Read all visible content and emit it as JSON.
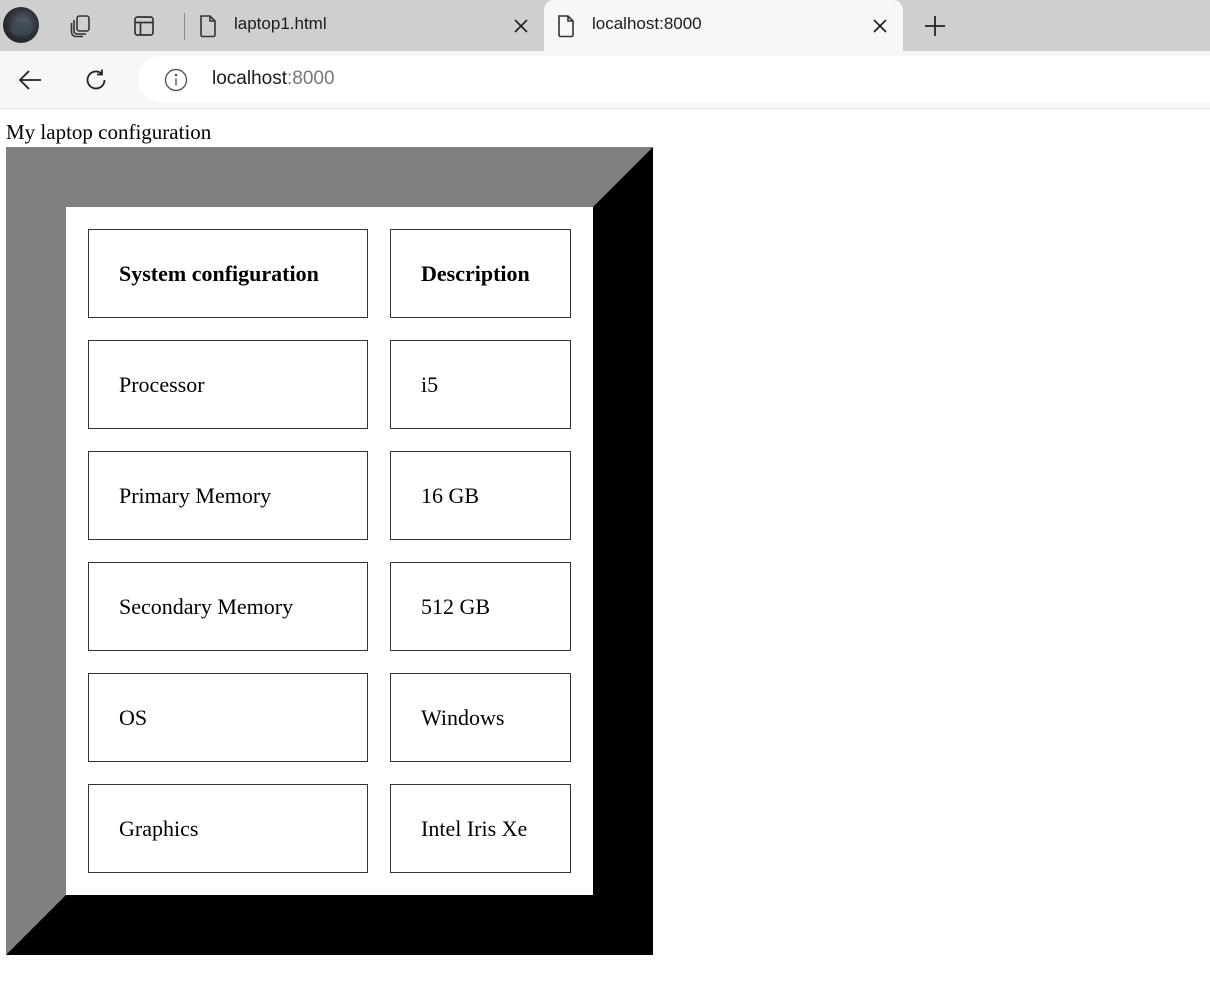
{
  "browser": {
    "tabs": [
      {
        "label": "laptop1.html",
        "active": false
      },
      {
        "label": "localhost:8000",
        "active": true
      }
    ],
    "address": {
      "host": "localhost",
      "port": ":8000"
    }
  },
  "page": {
    "title": "My laptop configuration",
    "table": {
      "headers": [
        "System configuration",
        "Description"
      ],
      "rows": [
        [
          "Processor",
          "i5"
        ],
        [
          "Primary Memory",
          "16 GB"
        ],
        [
          "Secondary Memory",
          "512 GB"
        ],
        [
          "OS",
          "Windows"
        ],
        [
          "Graphics",
          "Intel Iris Xe"
        ]
      ]
    }
  },
  "colors": {
    "tabstrip": "#cfcfcf",
    "toolbar": "#f7f7f7",
    "frame_light": "#808080",
    "frame_dark": "#2e2e2e"
  },
  "icons": [
    "profile-avatar",
    "workspaces-icon",
    "tab-actions-icon",
    "page-icon",
    "close-icon",
    "plus-icon",
    "back-arrow-icon",
    "reload-icon",
    "info-icon"
  ]
}
